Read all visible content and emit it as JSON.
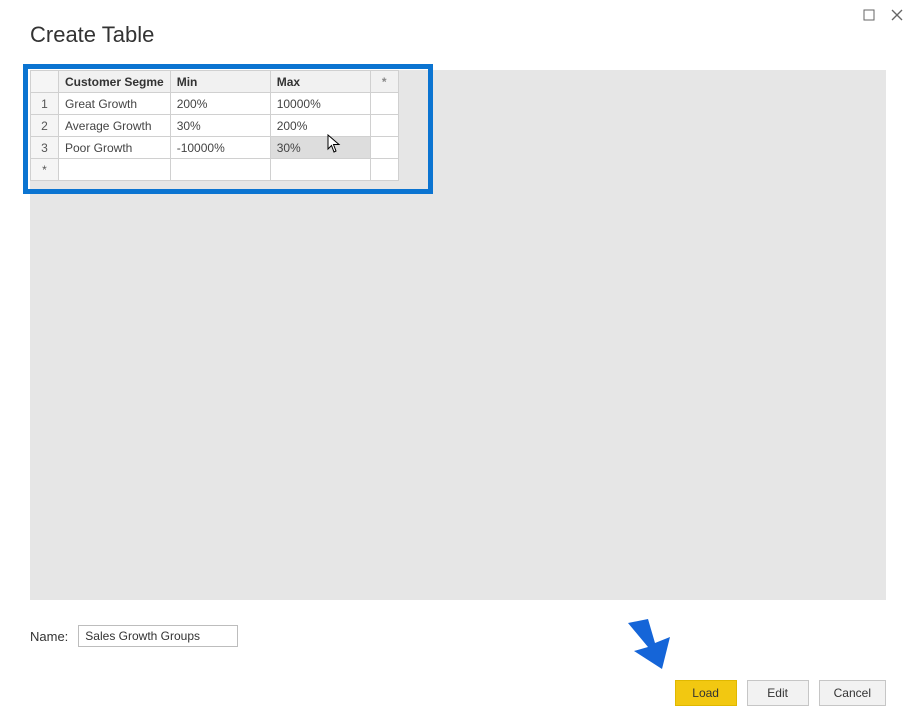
{
  "window": {
    "title": "Create Table"
  },
  "table": {
    "headers": {
      "segment": "Customer Segme",
      "min": "Min",
      "max": "Max",
      "star": "*"
    },
    "rows": [
      {
        "n": "1",
        "segment": "Great Growth",
        "min": "200%",
        "max": "10000%"
      },
      {
        "n": "2",
        "segment": "Average Growth",
        "min": "30%",
        "max": "200%"
      },
      {
        "n": "3",
        "segment": "Poor Growth",
        "min": "-10000%",
        "max": "30%"
      }
    ],
    "new_row_marker": "*"
  },
  "name_field": {
    "label": "Name:",
    "value": "Sales Growth Groups"
  },
  "buttons": {
    "load": "Load",
    "edit": "Edit",
    "cancel": "Cancel"
  }
}
